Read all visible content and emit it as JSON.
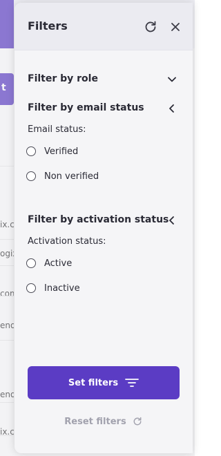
{
  "background": {
    "button_label": "t",
    "row_fragments": [
      "ix.co",
      "ogix",
      "com",
      "enol",
      "enol",
      "ix.co"
    ]
  },
  "drawer": {
    "title": "Filters",
    "icons": {
      "refresh": "refresh-icon",
      "close": "close-icon"
    },
    "sections": [
      {
        "title": "Filter by role",
        "chevron": "chevron-down-icon"
      },
      {
        "title": "Filter by email status",
        "chevron": "chevron-left-icon",
        "field_label": "Email status:",
        "options": [
          "Verified",
          "Non verified"
        ]
      },
      {
        "title": "Filter by activation status",
        "chevron": "chevron-left-icon",
        "field_label": "Activation status:",
        "options": [
          "Active",
          "Inactive"
        ]
      }
    ],
    "set_filters_label": "Set filters",
    "reset_filters_label": "Reset filters"
  },
  "colors": {
    "accent": "#5b3cc4",
    "muted_text": "#a2a2ae",
    "text": "#2a2a35"
  }
}
